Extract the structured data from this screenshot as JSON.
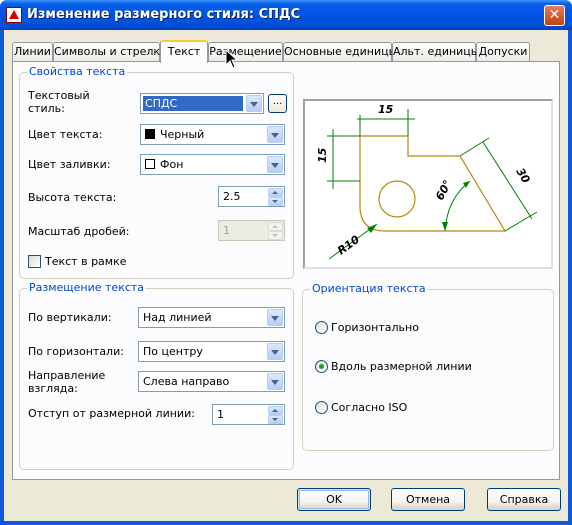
{
  "window": {
    "title": "Изменение размерного стиля: СПДС",
    "close_glyph": "✕"
  },
  "tabs": [
    {
      "label": "Линии"
    },
    {
      "label": "Символы и стрелки"
    },
    {
      "label": "Текст",
      "active": true
    },
    {
      "label": "Размещение"
    },
    {
      "label": "Основные единицы"
    },
    {
      "label": "Альт. единицы"
    },
    {
      "label": "Допуски"
    }
  ],
  "text_props": {
    "legend": "Свойства текста",
    "style_label": "Текстовый стиль:",
    "style_value": "СПДС",
    "style_button": "...",
    "color_label": "Цвет текста:",
    "color_value": "Черный",
    "fill_label": "Цвет заливки:",
    "fill_value": "Фон",
    "height_label": "Высота текста:",
    "height_value": "2.5",
    "fraction_label": "Масштаб дробей:",
    "fraction_value": "1",
    "frame_label": "Текст в рамке"
  },
  "text_placement": {
    "legend": "Размещение текста",
    "vertical_label": "По вертикали:",
    "vertical_value": "Над линией",
    "horizontal_label": "По горизонтали:",
    "horizontal_value": "По центру",
    "direction_label": "Направление взгляда:",
    "direction_value": "Слева направо",
    "offset_label": "Отступ от размерной линии:",
    "offset_value": "1"
  },
  "orientation": {
    "legend": "Ориентация текста",
    "options": [
      "Горизонтально",
      "Вдоль размерной линии",
      "Согласно ISO"
    ],
    "selected": 1
  },
  "preview": {
    "dims": [
      "15",
      "15",
      "30",
      "60°",
      "R10"
    ]
  },
  "buttons": {
    "ok": "OK",
    "cancel": "Отмена",
    "help": "Справка"
  },
  "colors": {
    "title_bar": "#0054e3",
    "dialog_bg": "#ece9d8",
    "group_title": "#0046d5",
    "preview_part": "#b8860b",
    "preview_dim": "#008000"
  }
}
